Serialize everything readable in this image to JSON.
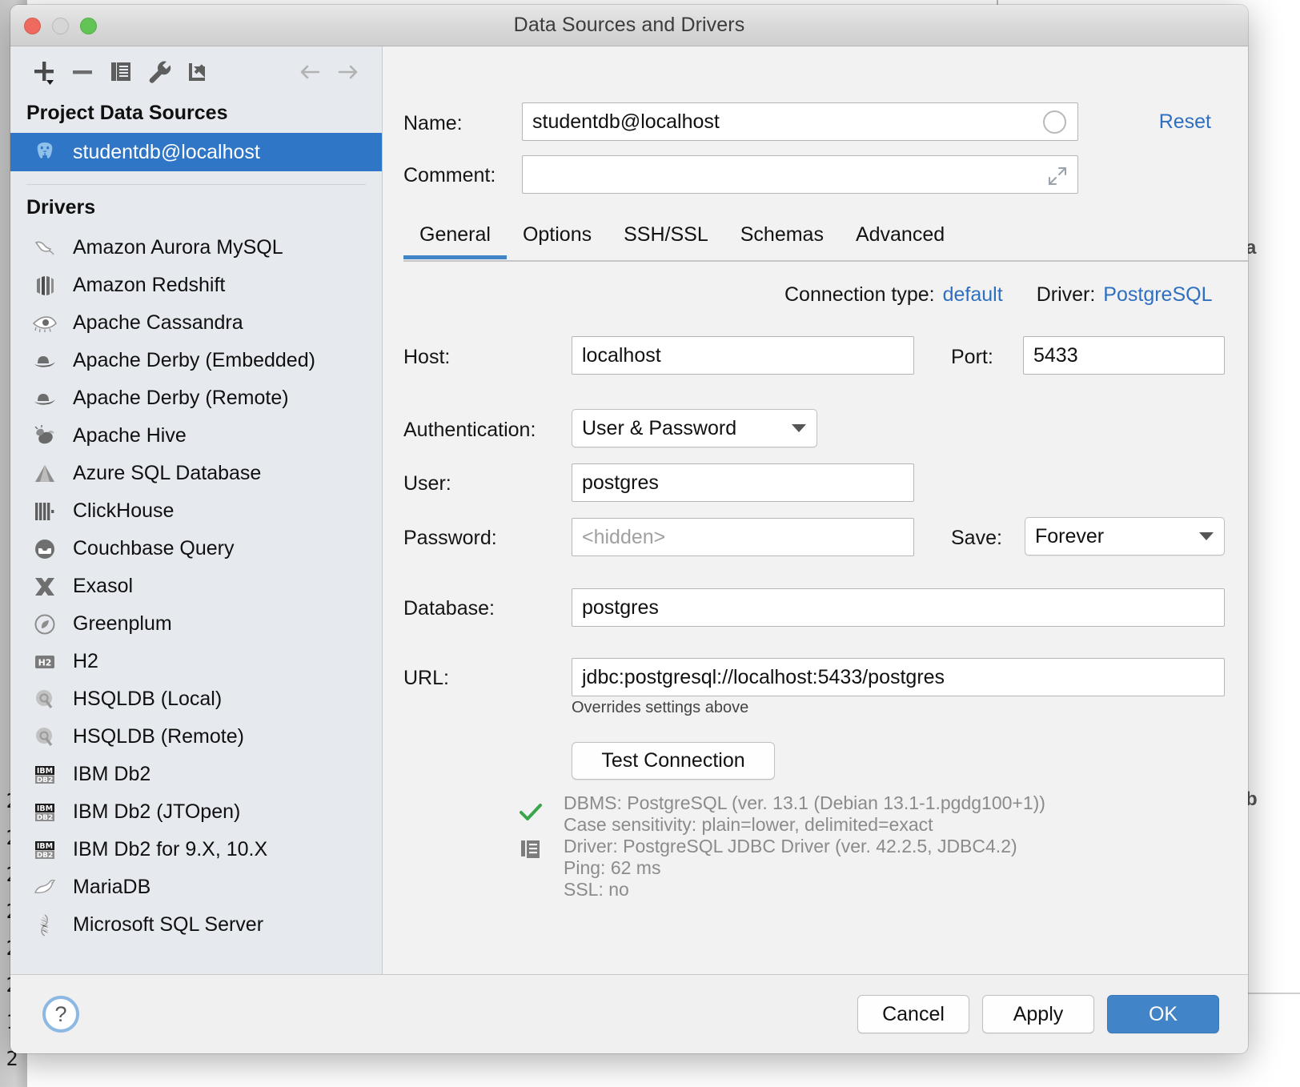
{
  "window": {
    "title": "Data Sources and Drivers",
    "traffic_lights": [
      "close",
      "minimize",
      "zoom"
    ]
  },
  "sidebar": {
    "toolbar": [
      {
        "name": "add-icon",
        "glyph": "+"
      },
      {
        "name": "remove-icon",
        "glyph": "−"
      },
      {
        "name": "copy-icon",
        "glyph": "copy"
      },
      {
        "name": "wrench-icon",
        "glyph": "wrench"
      },
      {
        "name": "import-icon",
        "glyph": "import"
      },
      {
        "name": "back-arrow-icon",
        "glyph": "←"
      },
      {
        "name": "forward-arrow-icon",
        "glyph": "→"
      }
    ],
    "project_header": "Project Data Sources",
    "data_sources": [
      {
        "label": "studentdb@localhost",
        "icon": "postgresql-icon",
        "selected": true
      }
    ],
    "drivers_header": "Drivers",
    "drivers": [
      {
        "label": "Amazon Aurora MySQL",
        "icon": "mysql-dolphin-icon"
      },
      {
        "label": "Amazon Redshift",
        "icon": "redshift-icon"
      },
      {
        "label": "Apache Cassandra",
        "icon": "cassandra-eye-icon"
      },
      {
        "label": "Apache Derby (Embedded)",
        "icon": "derby-hat-icon"
      },
      {
        "label": "Apache Derby (Remote)",
        "icon": "derby-hat-icon"
      },
      {
        "label": "Apache Hive",
        "icon": "hive-bee-icon"
      },
      {
        "label": "Azure SQL Database",
        "icon": "azure-icon"
      },
      {
        "label": "ClickHouse",
        "icon": "clickhouse-icon"
      },
      {
        "label": "Couchbase Query",
        "icon": "couchbase-icon"
      },
      {
        "label": "Exasol",
        "icon": "exasol-x-icon"
      },
      {
        "label": "Greenplum",
        "icon": "greenplum-icon"
      },
      {
        "label": "H2",
        "icon": "h2-icon"
      },
      {
        "label": "HSQLDB (Local)",
        "icon": "hsqldb-icon"
      },
      {
        "label": "HSQLDB (Remote)",
        "icon": "hsqldb-icon"
      },
      {
        "label": "IBM Db2",
        "icon": "ibm-db2-icon"
      },
      {
        "label": "IBM Db2 (JTOpen)",
        "icon": "ibm-db2-icon"
      },
      {
        "label": "IBM Db2 for 9.X, 10.X",
        "icon": "ibm-db2-icon"
      },
      {
        "label": "MariaDB",
        "icon": "mariadb-seal-icon"
      },
      {
        "label": "Microsoft SQL Server",
        "icon": "mssql-icon"
      }
    ]
  },
  "pane": {
    "name_label": "Name:",
    "name_value": "studentdb@localhost",
    "comment_label": "Comment:",
    "comment_value": "",
    "comment_placeholder": "",
    "reset_label": "Reset",
    "tabs": [
      {
        "label": "General",
        "active": true
      },
      {
        "label": "Options",
        "active": false
      },
      {
        "label": "SSH/SSL",
        "active": false
      },
      {
        "label": "Schemas",
        "active": false
      },
      {
        "label": "Advanced",
        "active": false
      }
    ],
    "connection_type_label": "Connection type:",
    "connection_type_value": "default",
    "driver_label": "Driver:",
    "driver_value": "PostgreSQL",
    "host_label": "Host:",
    "host_value": "localhost",
    "port_label": "Port:",
    "port_value": "5433",
    "auth_label": "Authentication:",
    "auth_value": "User & Password",
    "user_label": "User:",
    "user_value": "postgres",
    "password_label": "Password:",
    "password_placeholder": "<hidden>",
    "save_label": "Save:",
    "save_value": "Forever",
    "database_label": "Database:",
    "database_value": "postgres",
    "url_label": "URL:",
    "url_value": "jdbc:postgresql://localhost:5433/postgres",
    "overrides_note": "Overrides settings above",
    "test_connection_label": "Test Connection",
    "test_results": [
      "DBMS: PostgreSQL (ver. 13.1 (Debian 13.1-1.pgdg100+1))",
      "Case sensitivity: plain=lower, delimited=exact",
      "Driver: PostgreSQL JDBC Driver (ver. 42.2.5, JDBC4.2)",
      "Ping: 62 ms",
      "SSL: no"
    ]
  },
  "footer": {
    "help_label": "?",
    "cancel_label": "Cancel",
    "apply_label": "Apply",
    "ok_label": "OK"
  },
  "background": {
    "line_numbers": [
      "2",
      "2",
      "2",
      "2",
      "2",
      "2",
      "1",
      "2"
    ],
    "right_fragments": [
      "a",
      "b"
    ]
  },
  "colors": {
    "accent_blue": "#4284c8",
    "selection_blue": "#2f76c7",
    "link_blue": "#2f6fc0",
    "sidebar_bg": "#e6eaee",
    "pane_bg": "#f2f2f2",
    "success_green": "#3aa64b"
  }
}
